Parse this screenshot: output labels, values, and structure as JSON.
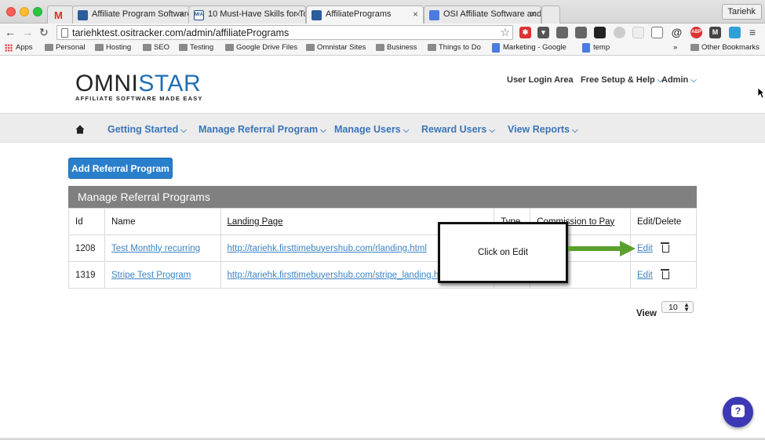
{
  "browser": {
    "tabs": [
      {
        "label": "",
        "favicon": "gmail-icon",
        "color": "#d93025"
      },
      {
        "label": "Affiliate Program Software",
        "favicon": "omnistar-icon",
        "color": "#2a5d9c"
      },
      {
        "label": "10 Must-Have Skills for To",
        "favicon": "mia-icon",
        "color": "#1b4f93"
      },
      {
        "label": "AffiliatePrograms",
        "favicon": "omnistar-icon",
        "color": "#2a5d9c"
      },
      {
        "label": "OSI Affiliate Software and S",
        "favicon": "doc-icon",
        "color": "#4a7be0"
      }
    ],
    "user": "Tariehk",
    "url": "tariehktest.ositracker.com/admin/affiliatePrograms",
    "bookmarks": [
      "Apps",
      "Personal",
      "Hosting",
      "SEO",
      "Testing",
      "Google Drive Files",
      "Omnistar Sites",
      "Business",
      "Things to Do",
      "Marketing - Google",
      "temp"
    ],
    "more_bookmarks": "»",
    "other_bookmarks": "Other Bookmarks"
  },
  "site": {
    "logo_part1": "OMNI",
    "logo_part2": "STAR",
    "logo_tagline": "AFFILIATE SOFTWARE MADE EASY",
    "top_links": {
      "user_login": "User Login Area",
      "free_setup": "Free Setup & Help",
      "admin": "Admin"
    },
    "nav": [
      "Getting Started",
      "Manage Referral Program",
      "Manage Users",
      "Reward Users",
      "View Reports"
    ]
  },
  "main": {
    "add_button": "Add Referral Program",
    "panel_title": "Manage Referral Programs",
    "columns": [
      "Id",
      "Name",
      "Landing Page",
      "Type",
      "Commission to Pay",
      "Edit/Delete"
    ],
    "rows": [
      {
        "id": "1208",
        "name": "Test Monthly recurring",
        "landing": "http://tariehk.firsttimebuyershub.com/rlanding.html",
        "edit": "Edit"
      },
      {
        "id": "1319",
        "name": "Stripe Test Program",
        "landing": "http://tariehk.firsttimebuyershub.com/stripe_landing.html",
        "edit": "Edit"
      }
    ],
    "callout": "Click on Edit",
    "view_label": "View",
    "view_value": "10"
  },
  "colors": {
    "accent": "#2a7fcc",
    "link": "#3d84c6",
    "panel": "#808080",
    "arrow": "#5aa02c",
    "help": "#3d39b4"
  }
}
